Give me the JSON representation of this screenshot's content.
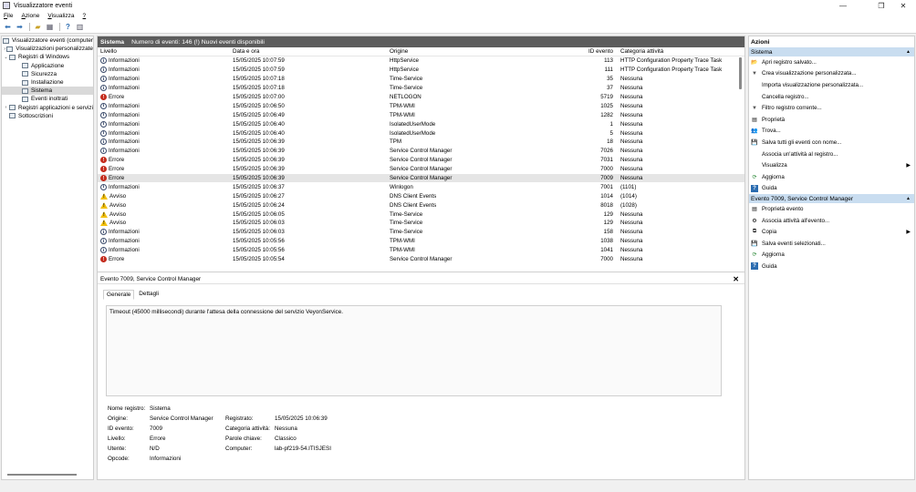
{
  "window": {
    "title": "Visualizzatore eventi",
    "min": "—",
    "max": "❐",
    "close": "✕"
  },
  "menu": [
    {
      "label": "File",
      "key": "F",
      "rest": "ile"
    },
    {
      "label": "Azione",
      "key": "A",
      "rest": "zione"
    },
    {
      "label": "Visualizza",
      "key": "V",
      "rest": "isualizza"
    },
    {
      "label": "?",
      "key": "?",
      "rest": ""
    }
  ],
  "toolbar": {
    "icons": [
      "back-icon",
      "forward-icon",
      "folder-up-icon",
      "console-tree-icon",
      "help-icon",
      "properties-icon"
    ]
  },
  "tree": [
    {
      "label": "Visualizzatore eventi (computer",
      "caret": "",
      "indent": 0,
      "selected": false
    },
    {
      "label": "Visualizzazioni personalizzate",
      "caret": "›",
      "indent": 0,
      "selected": false
    },
    {
      "label": "Registri di Windows",
      "caret": "⌄",
      "indent": 0,
      "selected": false
    },
    {
      "label": "Applicazione",
      "caret": "",
      "indent": 1,
      "selected": false
    },
    {
      "label": "Sicurezza",
      "caret": "",
      "indent": 1,
      "selected": false
    },
    {
      "label": "Installazione",
      "caret": "",
      "indent": 1,
      "selected": false
    },
    {
      "label": "Sistema",
      "caret": "",
      "indent": 1,
      "selected": true
    },
    {
      "label": "Eventi inoltrati",
      "caret": "",
      "indent": 1,
      "selected": false
    },
    {
      "label": "Registri applicazioni e servizi",
      "caret": "›",
      "indent": 0,
      "selected": false
    },
    {
      "label": "Sottoscrizioni",
      "caret": "",
      "indent": 0,
      "selected": false
    }
  ],
  "log": {
    "name": "Sistema",
    "count_text": "Numero di eventi: 146 (!) Nuovi eventi disponibili",
    "columns": [
      "Livello",
      "Data e ora",
      "Origine",
      "ID evento",
      "Categoria attività"
    ],
    "rows": [
      {
        "level": "Informazioni",
        "type": "info",
        "date": "15/05/2025 10:07:59",
        "source": "HttpService",
        "id": "113",
        "cat": "HTTP Configuration Property Trace Task"
      },
      {
        "level": "Informazioni",
        "type": "info",
        "date": "15/05/2025 10:07:59",
        "source": "HttpService",
        "id": "111",
        "cat": "HTTP Configuration Property Trace Task"
      },
      {
        "level": "Informazioni",
        "type": "info",
        "date": "15/05/2025 10:07:18",
        "source": "Time-Service",
        "id": "35",
        "cat": "Nessuna"
      },
      {
        "level": "Informazioni",
        "type": "info",
        "date": "15/05/2025 10:07:18",
        "source": "Time-Service",
        "id": "37",
        "cat": "Nessuna"
      },
      {
        "level": "Errore",
        "type": "err",
        "date": "15/05/2025 10:07:00",
        "source": "NETLOGON",
        "id": "5719",
        "cat": "Nessuna"
      },
      {
        "level": "Informazioni",
        "type": "info",
        "date": "15/05/2025 10:06:50",
        "source": "TPM-WMI",
        "id": "1025",
        "cat": "Nessuna"
      },
      {
        "level": "Informazioni",
        "type": "info",
        "date": "15/05/2025 10:06:49",
        "source": "TPM-WMI",
        "id": "1282",
        "cat": "Nessuna"
      },
      {
        "level": "Informazioni",
        "type": "info",
        "date": "15/05/2025 10:06:40",
        "source": "IsolatedUserMode",
        "id": "1",
        "cat": "Nessuna"
      },
      {
        "level": "Informazioni",
        "type": "info",
        "date": "15/05/2025 10:06:40",
        "source": "IsolatedUserMode",
        "id": "5",
        "cat": "Nessuna"
      },
      {
        "level": "Informazioni",
        "type": "info",
        "date": "15/05/2025 10:06:39",
        "source": "TPM",
        "id": "18",
        "cat": "Nessuna"
      },
      {
        "level": "Informazioni",
        "type": "info",
        "date": "15/05/2025 10:06:39",
        "source": "Service Control Manager",
        "id": "7026",
        "cat": "Nessuna"
      },
      {
        "level": "Errore",
        "type": "err",
        "date": "15/05/2025 10:06:39",
        "source": "Service Control Manager",
        "id": "7031",
        "cat": "Nessuna"
      },
      {
        "level": "Errore",
        "type": "err",
        "date": "15/05/2025 10:06:39",
        "source": "Service Control Manager",
        "id": "7000",
        "cat": "Nessuna"
      },
      {
        "level": "Errore",
        "type": "err",
        "date": "15/05/2025 10:06:39",
        "source": "Service Control Manager",
        "id": "7009",
        "cat": "Nessuna",
        "selected": true
      },
      {
        "level": "Informazioni",
        "type": "info",
        "date": "15/05/2025 10:06:37",
        "source": "Winlogon",
        "id": "7001",
        "cat": "(1101)"
      },
      {
        "level": "Avviso",
        "type": "warn",
        "date": "15/05/2025 10:06:27",
        "source": "DNS Client Events",
        "id": "1014",
        "cat": "(1014)"
      },
      {
        "level": "Avviso",
        "type": "warn",
        "date": "15/05/2025 10:06:24",
        "source": "DNS Client Events",
        "id": "8018",
        "cat": "(1028)"
      },
      {
        "level": "Avviso",
        "type": "warn",
        "date": "15/05/2025 10:06:05",
        "source": "Time-Service",
        "id": "129",
        "cat": "Nessuna"
      },
      {
        "level": "Avviso",
        "type": "warn",
        "date": "15/05/2025 10:06:03",
        "source": "Time-Service",
        "id": "129",
        "cat": "Nessuna"
      },
      {
        "level": "Informazioni",
        "type": "info",
        "date": "15/05/2025 10:06:03",
        "source": "Time-Service",
        "id": "158",
        "cat": "Nessuna"
      },
      {
        "level": "Informazioni",
        "type": "info",
        "date": "15/05/2025 10:05:56",
        "source": "TPM-WMI",
        "id": "1038",
        "cat": "Nessuna"
      },
      {
        "level": "Informazioni",
        "type": "info",
        "date": "15/05/2025 10:05:56",
        "source": "TPM-WMI",
        "id": "1041",
        "cat": "Nessuna"
      },
      {
        "level": "Errore",
        "type": "err",
        "date": "15/05/2025 10:05:54",
        "source": "Service Control Manager",
        "id": "7000",
        "cat": "Nessuna"
      }
    ]
  },
  "detail": {
    "title": "Evento 7009, Service Control Manager",
    "close": "✕",
    "tabs": [
      "Generale",
      "Dettagli"
    ],
    "message": "Timeout (45000 millisecondi) durante l'attesa della connessione del servizio VeyonService.",
    "props": [
      {
        "l1": "Nome registro:",
        "v1": "Sistema",
        "l2": "",
        "v2": ""
      },
      {
        "l1": "Origine:",
        "v1": "Service Control Manager",
        "l2": "Registrato:",
        "v2": "15/05/2025 10:06:39"
      },
      {
        "l1": "ID evento:",
        "v1": "7009",
        "l2": "Categoria attività:",
        "v2": "Nessuna"
      },
      {
        "l1": "Livello:",
        "v1": "Errore",
        "l2": "Parole chiave:",
        "v2": "Classico"
      },
      {
        "l1": "Utente:",
        "v1": "N/D",
        "l2": "Computer:",
        "v2": "lab-pf219-54.ITISJESI"
      },
      {
        "l1": "Opcode:",
        "v1": "Informazioni",
        "l2": "",
        "v2": ""
      }
    ]
  },
  "actions": {
    "title": "Azioni",
    "sections": [
      {
        "header": "Sistema",
        "items": [
          {
            "label": "Apri registro salvato...",
            "icon": "folder-open-icon",
            "glyph": "📂",
            "sub": ""
          },
          {
            "label": "Crea visualizzazione personalizzata...",
            "icon": "filter-icon",
            "glyph": "▼",
            "sub": ""
          },
          {
            "label": "Importa visualizzazione personalizzata...",
            "icon": "import-icon",
            "glyph": "",
            "sub": ""
          },
          {
            "label": "Cancella registro...",
            "icon": "clear-log-icon",
            "glyph": "",
            "sub": ""
          },
          {
            "label": "Filtro registro corrente...",
            "icon": "filter-icon",
            "glyph": "▼",
            "sub": ""
          },
          {
            "label": "Proprietà",
            "icon": "properties-icon",
            "glyph": "▤",
            "sub": ""
          },
          {
            "label": "Trova...",
            "icon": "find-icon",
            "glyph": "👥",
            "sub": ""
          },
          {
            "label": "Salva tutti gli eventi con nome...",
            "icon": "save-icon",
            "glyph": "💾",
            "sub": ""
          },
          {
            "label": "Associa un'attività al registro...",
            "icon": "task-icon",
            "glyph": "",
            "sub": ""
          },
          {
            "label": "Visualizza",
            "icon": "view-icon",
            "glyph": "",
            "sub": "▶"
          },
          {
            "label": "Aggiorna",
            "icon": "refresh-icon",
            "glyph": "⟳",
            "sub": ""
          },
          {
            "label": "Guida",
            "icon": "help-icon",
            "glyph": "?",
            "sub": ""
          }
        ]
      },
      {
        "header": "Evento 7009, Service Control Manager",
        "items": [
          {
            "label": "Proprietà evento",
            "icon": "event-properties-icon",
            "glyph": "▤",
            "sub": ""
          },
          {
            "label": "Associa attività all'evento...",
            "icon": "task-icon",
            "glyph": "⚙",
            "sub": ""
          },
          {
            "label": "Copia",
            "icon": "copy-icon",
            "glyph": "⧉",
            "sub": "▶"
          },
          {
            "label": "Salva eventi selezionati...",
            "icon": "save-icon",
            "glyph": "💾",
            "sub": ""
          },
          {
            "label": "Aggiorna",
            "icon": "refresh-icon",
            "glyph": "⟳",
            "sub": ""
          },
          {
            "label": "Guida",
            "icon": "help-icon",
            "glyph": "?",
            "sub": ""
          }
        ]
      }
    ]
  },
  "colors": {
    "accent_section": "#c9ddf0",
    "header_bar": "#5c5c5c",
    "error": "#c42b1c",
    "warning": "#f3c10c"
  }
}
